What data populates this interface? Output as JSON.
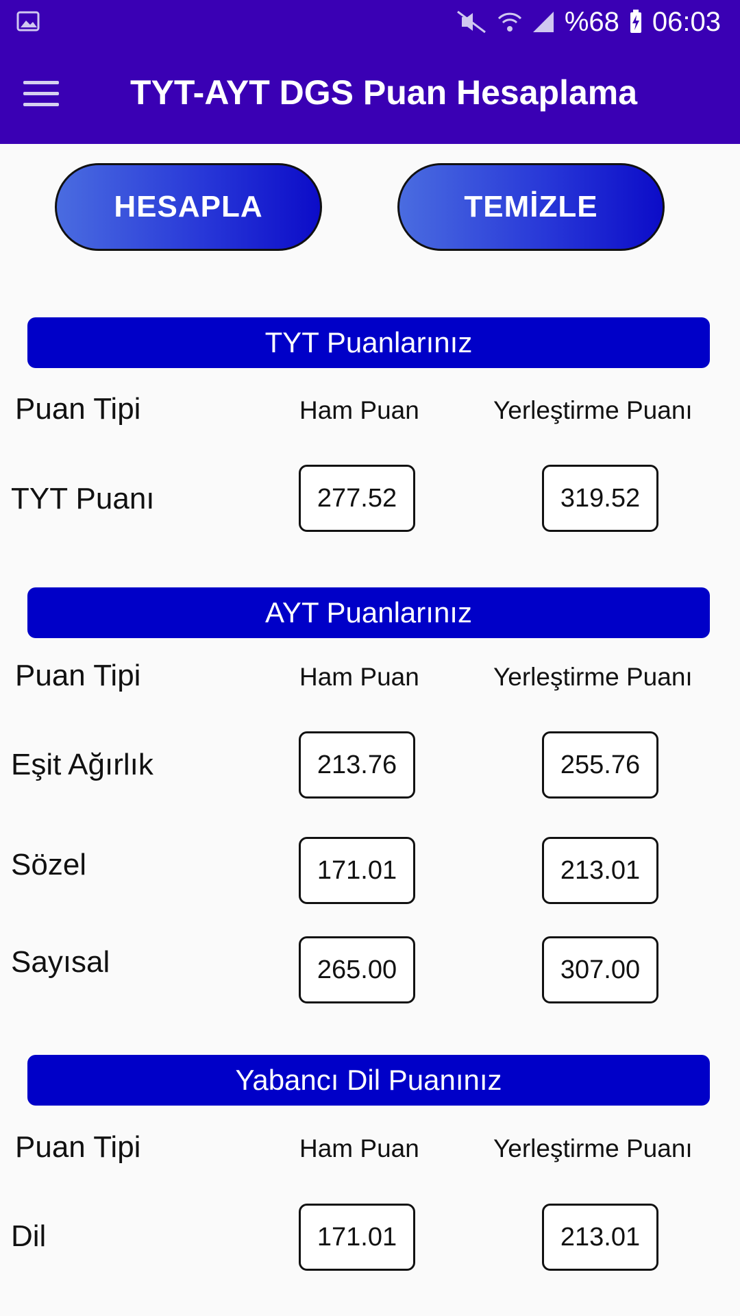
{
  "status_bar": {
    "battery": "%68",
    "time": "06:03",
    "icons": [
      "image-icon",
      "mute-icon",
      "wifi-icon",
      "signal-icon",
      "battery-charging-icon"
    ]
  },
  "app_bar": {
    "title": "TYT-AYT DGS Puan Hesaplama",
    "menu_icon": "hamburger-menu-icon"
  },
  "actions": {
    "calculate_label": "HESAPLA",
    "clear_label": "TEMİZLE"
  },
  "tyt": {
    "header": "TYT Puanlarınız",
    "col_type": "Puan Tipi",
    "col_ham": "Ham Puan",
    "col_yer": "Yerleştirme Puanı",
    "rows": [
      {
        "label": "TYT Puanı",
        "ham": "277.52",
        "yer": "319.52"
      }
    ]
  },
  "ayt": {
    "header": "AYT Puanlarınız",
    "col_type": "Puan Tipi",
    "col_ham": "Ham Puan",
    "col_yer": "Yerleştirme Puanı",
    "rows": [
      {
        "label": "Eşit Ağırlık",
        "ham": "213.76",
        "yer": "255.76"
      },
      {
        "label": "Sözel",
        "ham": "171.01",
        "yer": "213.01"
      },
      {
        "label": "Sayısal",
        "ham": "265.00",
        "yer": "307.00"
      }
    ]
  },
  "yabanci_dil": {
    "header": "Yabancı Dil Puanınız",
    "col_type": "Puan Tipi",
    "col_ham": "Ham Puan",
    "col_yer": "Yerleştirme Puanı",
    "rows": [
      {
        "label": "Dil",
        "ham": "171.01",
        "yer": "213.01"
      }
    ]
  },
  "colors": {
    "app_bar": "#3a00b4",
    "section_header": "#0000c8",
    "button_start": "#4a6ce0",
    "button_end": "#0c0cc8"
  }
}
